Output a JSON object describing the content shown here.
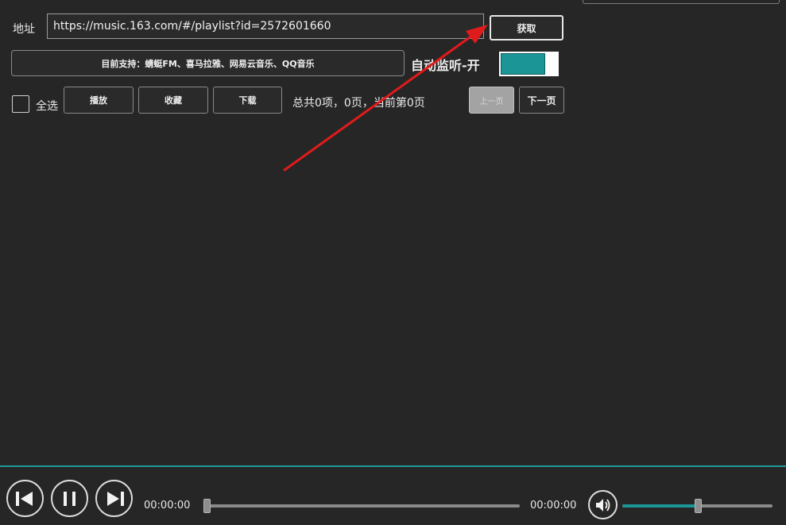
{
  "header": {
    "address_label": "地址",
    "url_value": "https://music.163.com/#/playlist?id=2572601660",
    "fetch_label": "获取",
    "support_text": "目前支持：蜻蜓FM、喜马拉雅、网易云音乐、QQ音乐",
    "auto_listen_label": "自动监听-开"
  },
  "toolbar": {
    "select_all_label": "全选",
    "play_label": "播放",
    "favorite_label": "收藏",
    "download_label": "下载",
    "page_info": "总共0项，0页，当前第0页",
    "prev_label": "上一页",
    "next_label": "下一页"
  },
  "player": {
    "current_time": "00:00:00",
    "total_time": "00:00:00",
    "progress": 0,
    "volume": 0.5
  },
  "colors": {
    "accent": "#1b9595",
    "annotation_arrow": "#e01b1b",
    "background": "#262626"
  }
}
